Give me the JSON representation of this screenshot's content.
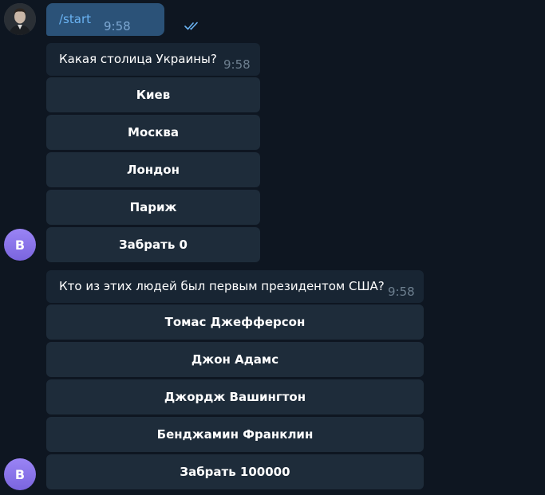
{
  "outgoing": {
    "command": "/start",
    "time": "9:58"
  },
  "questions": [
    {
      "text": "Какая столица Украины?",
      "time": "9:58",
      "answers": [
        "Киев",
        "Москва",
        "Лондон",
        "Париж"
      ],
      "take_button": "Забрать 0",
      "avatar_letter": "B"
    },
    {
      "text": "Кто из этих людей был первым президентом США?",
      "time": "9:58",
      "answers": [
        "Томас Джефферсон",
        "Джон Адамс",
        "Джордж Вашингтон",
        "Бенджамин Франклин"
      ],
      "take_button": "Забрать 100000",
      "avatar_letter": "B"
    }
  ],
  "colors": {
    "background": "#0e1621",
    "outgoing_bubble": "#2b5278",
    "incoming_bubble": "#182533",
    "keyboard_button": "#1e2c3a",
    "command_link": "#6ab3f3",
    "bot_avatar": "#8a74ec"
  },
  "icons": {
    "user_avatar": "user-photo",
    "read_receipt": "double-check-icon"
  }
}
